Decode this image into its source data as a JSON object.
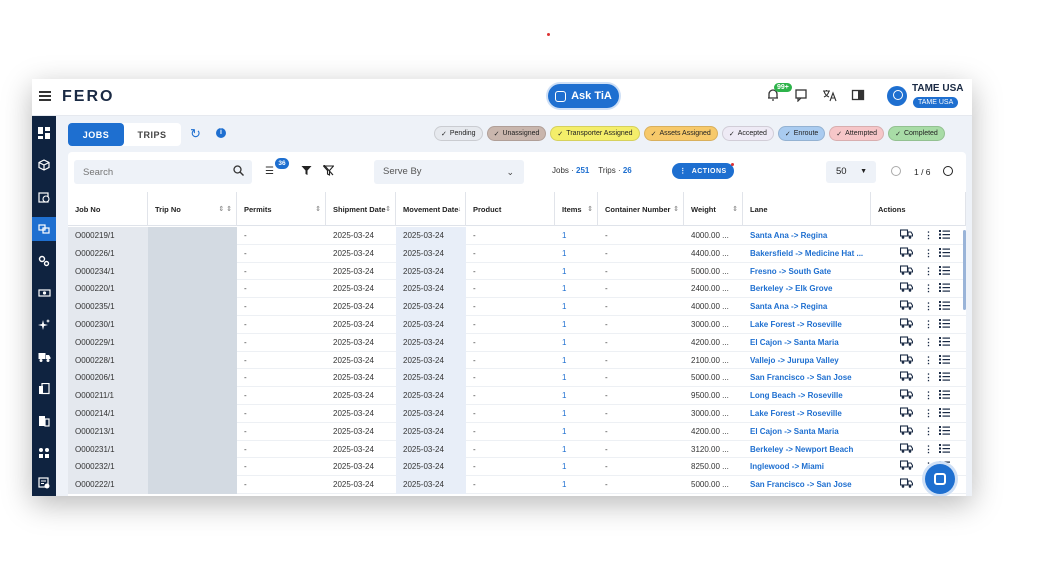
{
  "app": {
    "logo": "FERO",
    "ask_label": "Ask TiA",
    "notifications_badge": "99+",
    "user_name": "TAME USA",
    "user_org": "TAME USA"
  },
  "tabs": [
    "JOBS",
    "TRIPS"
  ],
  "statuses": [
    {
      "label": "Pending",
      "color": "#e6e9ee"
    },
    {
      "label": "Unassigned",
      "color": "#c9b6ad"
    },
    {
      "label": "Transporter Assigned",
      "color": "#f4ee6a"
    },
    {
      "label": "Assets Assigned",
      "color": "#f7c96a"
    },
    {
      "label": "Accepted",
      "color": "#eeeaf5"
    },
    {
      "label": "Enroute",
      "color": "#a9cbf0"
    },
    {
      "label": "Attempted",
      "color": "#f6c6c8"
    },
    {
      "label": "Completed",
      "color": "#a8dca6"
    }
  ],
  "toolbar": {
    "search_placeholder": "Search",
    "filter_badge": "36",
    "serve_by": "Serve By",
    "jobs_label": "Jobs",
    "jobs_count": "251",
    "trips_label": "Trips",
    "trips_count": "26",
    "actions_label": "ACTIONS",
    "per_page": "50",
    "page": "1 / 6"
  },
  "columns": [
    "Job No",
    "Trip No",
    "Permits",
    "Shipment Date",
    "Movement Date",
    "Product",
    "Items",
    "Container Number",
    "Weight",
    "Lane",
    "Actions"
  ],
  "rows": [
    {
      "job": "O000219/1",
      "trip": "",
      "permits": "-",
      "ship": "2025-03-24",
      "move": "2025-03-24",
      "product": "-",
      "items": "1",
      "container": "-",
      "weight": "4000.00 ...",
      "lane": "Santa Ana -> Regina"
    },
    {
      "job": "O000226/1",
      "trip": "",
      "permits": "-",
      "ship": "2025-03-24",
      "move": "2025-03-24",
      "product": "-",
      "items": "1",
      "container": "-",
      "weight": "4400.00 ...",
      "lane": "Bakersfield -> Medicine Hat ..."
    },
    {
      "job": "O000234/1",
      "trip": "",
      "permits": "-",
      "ship": "2025-03-24",
      "move": "2025-03-24",
      "product": "-",
      "items": "1",
      "container": "-",
      "weight": "5000.00 ...",
      "lane": "Fresno -> South Gate"
    },
    {
      "job": "O000220/1",
      "trip": "",
      "permits": "-",
      "ship": "2025-03-24",
      "move": "2025-03-24",
      "product": "-",
      "items": "1",
      "container": "-",
      "weight": "2400.00 ...",
      "lane": "Berkeley -> Elk Grove"
    },
    {
      "job": "O000235/1",
      "trip": "",
      "permits": "-",
      "ship": "2025-03-24",
      "move": "2025-03-24",
      "product": "-",
      "items": "1",
      "container": "-",
      "weight": "4000.00 ...",
      "lane": "Santa Ana -> Regina"
    },
    {
      "job": "O000230/1",
      "trip": "",
      "permits": "-",
      "ship": "2025-03-24",
      "move": "2025-03-24",
      "product": "-",
      "items": "1",
      "container": "-",
      "weight": "3000.00 ...",
      "lane": "Lake Forest -> Roseville"
    },
    {
      "job": "O000229/1",
      "trip": "",
      "permits": "-",
      "ship": "2025-03-24",
      "move": "2025-03-24",
      "product": "-",
      "items": "1",
      "container": "-",
      "weight": "4200.00 ...",
      "lane": "El Cajon -> Santa Maria"
    },
    {
      "job": "O000228/1",
      "trip": "",
      "permits": "-",
      "ship": "2025-03-24",
      "move": "2025-03-24",
      "product": "-",
      "items": "1",
      "container": "-",
      "weight": "2100.00 ...",
      "lane": "Vallejo -> Jurupa Valley"
    },
    {
      "job": "O000206/1",
      "trip": "",
      "permits": "-",
      "ship": "2025-03-24",
      "move": "2025-03-24",
      "product": "-",
      "items": "1",
      "container": "-",
      "weight": "5000.00 ...",
      "lane": "San Francisco -> San Jose"
    },
    {
      "job": "O000211/1",
      "trip": "",
      "permits": "-",
      "ship": "2025-03-24",
      "move": "2025-03-24",
      "product": "-",
      "items": "1",
      "container": "-",
      "weight": "9500.00 ...",
      "lane": "Long Beach -> Roseville"
    },
    {
      "job": "O000214/1",
      "trip": "",
      "permits": "-",
      "ship": "2025-03-24",
      "move": "2025-03-24",
      "product": "-",
      "items": "1",
      "container": "-",
      "weight": "3000.00 ...",
      "lane": "Lake Forest -> Roseville"
    },
    {
      "job": "O000213/1",
      "trip": "",
      "permits": "-",
      "ship": "2025-03-24",
      "move": "2025-03-24",
      "product": "-",
      "items": "1",
      "container": "-",
      "weight": "4200.00 ...",
      "lane": "El Cajon -> Santa Maria"
    },
    {
      "job": "O000231/1",
      "trip": "",
      "permits": "-",
      "ship": "2025-03-24",
      "move": "2025-03-24",
      "product": "-",
      "items": "1",
      "container": "-",
      "weight": "3120.00 ...",
      "lane": "Berkeley -> Newport Beach"
    },
    {
      "job": "O000232/1",
      "trip": "",
      "permits": "-",
      "ship": "2025-03-24",
      "move": "2025-03-24",
      "product": "-",
      "items": "1",
      "container": "-",
      "weight": "8250.00 ...",
      "lane": "Inglewood -> Miami"
    },
    {
      "job": "O000222/1",
      "trip": "",
      "permits": "-",
      "ship": "2025-03-24",
      "move": "2025-03-24",
      "product": "-",
      "items": "1",
      "container": "-",
      "weight": "5000.00 ...",
      "lane": "San Francisco -> San Jose"
    }
  ],
  "colors": {
    "primary": "#1e6fd0",
    "sidebar": "#0f2340"
  }
}
